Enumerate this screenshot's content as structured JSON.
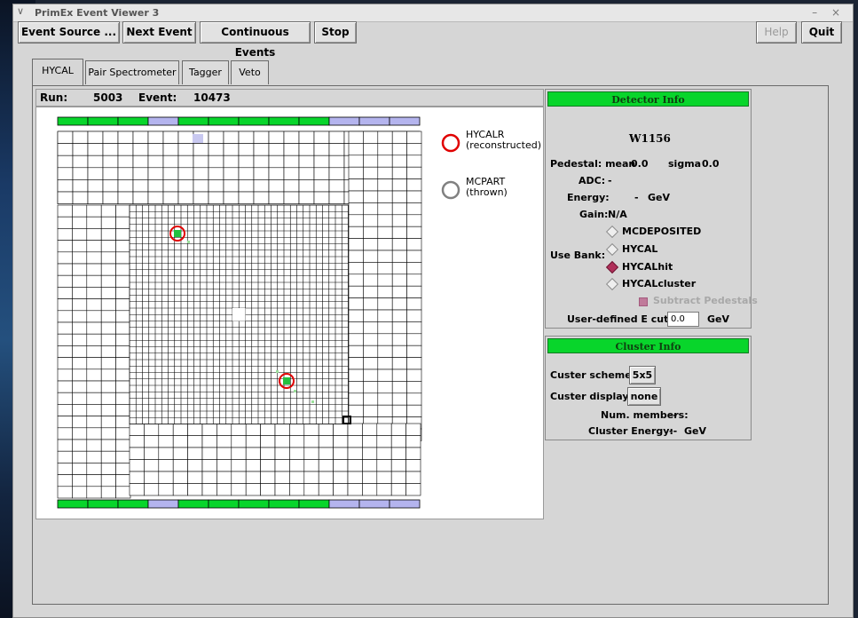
{
  "window": {
    "title": "PrimEx Event Viewer 3",
    "menu_glyph": "∨",
    "controls": "– ×"
  },
  "toolbar": {
    "event_source": "Event Source ...",
    "next_event": "Next Event",
    "continuous_events": "Continuous Events",
    "stop": "Stop",
    "help": "Help",
    "quit": "Quit"
  },
  "tabs": [
    {
      "label": "HYCAL",
      "active": true
    },
    {
      "label": "Pair Spectrometer",
      "active": false
    },
    {
      "label": "Tagger",
      "active": false
    },
    {
      "label": "Veto",
      "active": false
    }
  ],
  "runbar": {
    "run_label": "Run:",
    "run_value": "5003",
    "event_label": "Event:",
    "event_value": "10473"
  },
  "legend": {
    "reconstructed_name": "HYCALR",
    "reconstructed_note": "(reconstructed)",
    "thrown_name": "MCPART",
    "thrown_note": "(thrown)"
  },
  "colors": {
    "accent_green": "#08d52b",
    "lavender": "#b4b4ee",
    "hit_green": "#22c040",
    "reco_red": "#e00000"
  },
  "strip_pattern": [
    "green",
    "green",
    "green",
    "lavender",
    "green",
    "green",
    "green",
    "green",
    "green",
    "lavender",
    "lavender",
    "lavender"
  ],
  "detector_info": {
    "title": "Detector Info",
    "block_id": "W1156",
    "pedestal_mean_label": "Pedestal: mean",
    "pedestal_mean": "0.0",
    "pedestal_sigma_label": "sigma",
    "pedestal_sigma": "0.0",
    "adc_label": "ADC:",
    "adc_value": "-",
    "energy_label": "Energy:",
    "energy_value": "-",
    "energy_unit": "GeV",
    "gain_label": "Gain:",
    "gain_value": "N/A",
    "use_bank_label": "Use Bank:",
    "banks": [
      {
        "label": "MCDEPOSITED",
        "selected": false
      },
      {
        "label": "HYCAL",
        "selected": false
      },
      {
        "label": "HYCALhit",
        "selected": true
      },
      {
        "label": "HYCALcluster",
        "selected": false
      }
    ],
    "subtract_pedestals": "Subtract Pedestals",
    "ecut_label": "User-defined E cut:",
    "ecut_value": "0.0",
    "ecut_unit": "GeV"
  },
  "cluster_info": {
    "title": "Cluster Info",
    "scheme_label": "Custer scheme:",
    "scheme_value": "5x5",
    "display_label": "Custer display:",
    "display_value": "none",
    "members_label": "Num. members:",
    "members_value": "--",
    "energy_label": "Cluster Energy:",
    "energy_value": "--",
    "energy_unit": "GeV"
  }
}
